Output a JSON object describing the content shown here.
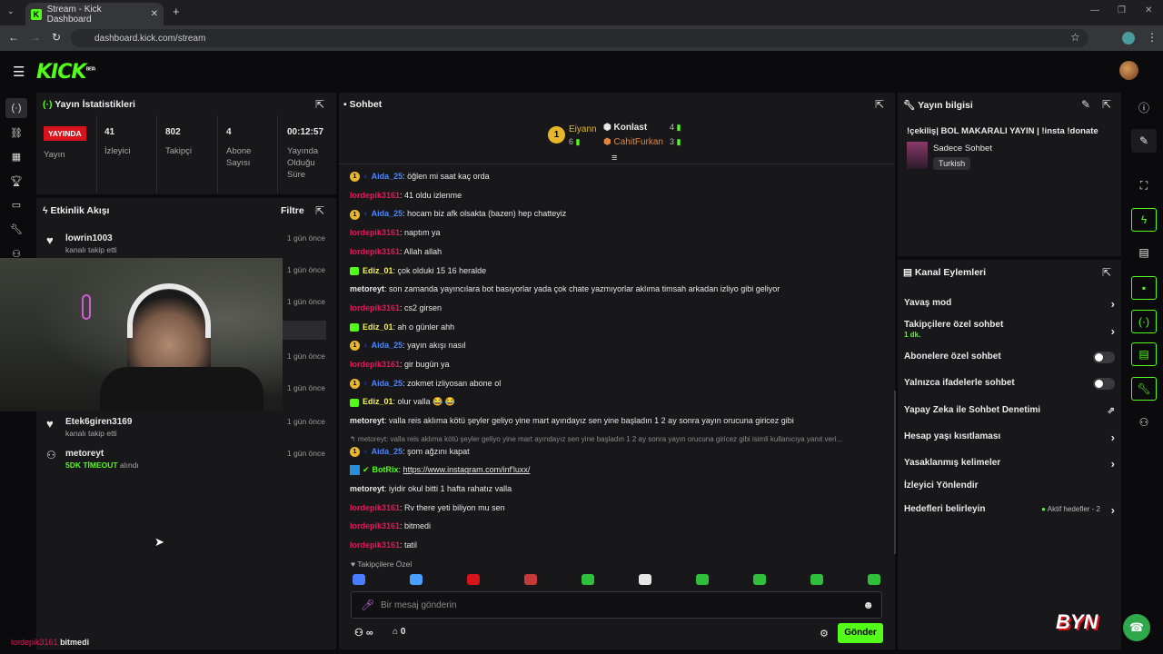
{
  "browser": {
    "tab_title": "Stream - Kick Dashboard",
    "url": "dashboard.kick.com/stream"
  },
  "brand": {
    "logo": "KICK",
    "beta": "BETA",
    "accent": "#53fc18",
    "live_red": "#d8131b"
  },
  "stats": {
    "title": "Yayın İstatistikleri",
    "live_badge": "YAYINDA",
    "live_label": "Yayın",
    "items": [
      {
        "value": "41",
        "label": "İzleyici"
      },
      {
        "value": "802",
        "label": "Takipçi"
      },
      {
        "value": "4",
        "label": "Abone Sayısı"
      },
      {
        "value": "00:12:57",
        "label": "Yayında Olduğu Süre"
      }
    ]
  },
  "activity": {
    "title": "Etkinlik Akışı",
    "filter": "Filtre",
    "items": [
      {
        "name": "lowrin1003",
        "sub": "kanalı takip etti",
        "time": "1 gün önce"
      },
      {
        "time": "1 gün önce"
      },
      {
        "time": "1 gün önce"
      },
      {
        "time": "1 gün önce"
      },
      {
        "time": "1 gün önce"
      },
      {
        "name": "Etek6giren3169",
        "sub": "kanalı takip etti",
        "time": "1 gün önce"
      },
      {
        "name": "metoreyt",
        "sub_highlight": "5DK TİMEOUT",
        "sub": "alındı",
        "time": "1 gün önce"
      }
    ]
  },
  "chat": {
    "title": "Sohbet",
    "leaders": [
      {
        "rank": "1",
        "name": "Eiyann",
        "count": "6"
      },
      {
        "name": "Konlast",
        "count": "4"
      },
      {
        "name": "CahitFurkan",
        "count": "3"
      }
    ],
    "messages": [
      {
        "user": "Aida_25",
        "cls": "u-aida",
        "badge": "1",
        "text": "öğlen mi saat kaç orda"
      },
      {
        "user": "lordepik3161",
        "cls": "u-lord",
        "text": "41 oldu izlenme"
      },
      {
        "user": "Aida_25",
        "cls": "u-aida",
        "badge": "1",
        "text": "hocam biz afk olsakta (bazen) hep chatteyiz"
      },
      {
        "user": "lordepik3161",
        "cls": "u-lord",
        "text": "naptım ya"
      },
      {
        "user": "lordepik3161",
        "cls": "u-lord",
        "text": "Allah allah"
      },
      {
        "user": "Ediz_01",
        "cls": "u-ediz",
        "badge": "sub",
        "text": "çok olduki 15 16 heralde"
      },
      {
        "user": "metoreyt",
        "cls": "u-meto",
        "text": "son zamanda yayıncılara bot basıyorlar yada çok chate yazmıyorlar aklıma timsah arkadan izliyo gibi geliyor"
      },
      {
        "user": "lordepik3161",
        "cls": "u-lord",
        "text": "cs2 girsen"
      },
      {
        "user": "Ediz_01",
        "cls": "u-ediz",
        "badge": "sub",
        "text": "ah o günler ahh"
      },
      {
        "user": "Aida_25",
        "cls": "u-aida",
        "badge": "1",
        "text": "yayın akışı nasıl"
      },
      {
        "user": "lordepik3161",
        "cls": "u-lord",
        "text": "gir bugün ya"
      },
      {
        "user": "Aida_25",
        "cls": "u-aida",
        "badge": "1",
        "text": "zokmet izliyosan abone ol"
      },
      {
        "user": "Ediz_01",
        "cls": "u-ediz",
        "badge": "sub",
        "text": "olur valla 😂 😂"
      },
      {
        "user": "metoreyt",
        "cls": "u-meto",
        "text": "valla reis aklıma kötü şeyler geliyo yine mart ayındayız sen yine başladın 1 2 ay sonra yayın orucuna giricez gibi"
      },
      {
        "reply": "↰ metoreyt: valla reis aklıma kötü şeyler geliyo yine mart ayındayız sen yine başladın 1 2 ay sonra yayın orucuna giricez gibi isimli kullanıcıya yanıt veri..."
      },
      {
        "user": "Aida_25",
        "cls": "u-aida",
        "badge": "1",
        "text": "şom ağzını kapat"
      },
      {
        "user": "BotRix",
        "cls": "u-bot",
        "badge": "bot",
        "text": "https://www.instagram.com/inf'luxx/"
      },
      {
        "user": "metoreyt",
        "cls": "u-meto",
        "text": "iyidir okul bitti 1 hafta rahatız valla"
      },
      {
        "user": "lordepik3161",
        "cls": "u-lord",
        "text": "Rv there yeti biliyon mu sen"
      },
      {
        "user": "lordepik3161",
        "cls": "u-lord",
        "text": "bitmedi"
      },
      {
        "user": "lordepik3161",
        "cls": "u-lord",
        "text": "tatil"
      }
    ],
    "emote_label": "Takipçilere Özel",
    "placeholder": "Bir mesaj gönderin",
    "points": "∞",
    "gift_count": "0",
    "send": "Gönder"
  },
  "stream_info": {
    "title": "Yayın bilgisi",
    "stream_title": "!çekiliş| BOL MAKARALI YAYIN | !insta !donate",
    "category": "Sadece Sohbet",
    "language": "Turkish"
  },
  "channel_actions": {
    "title": "Kanal Eylemleri",
    "rows": [
      {
        "label": "Yavaş mod"
      },
      {
        "label": "Takipçilere özel sohbet",
        "sub": "1 dk."
      },
      {
        "label": "Abonelere özel sohbet"
      },
      {
        "label": "Yalnızca ifadelerle sohbet"
      },
      {
        "label": "Yapay Zeka ile Sohbet Denetimi"
      },
      {
        "label": "Hesap yaşı kısıtlaması"
      },
      {
        "label": "Yasaklanmış kelimeler"
      },
      {
        "label": "İzleyici Yönlendir"
      },
      {
        "label": "Hedefleri belirleyin",
        "sub": "Aktif hedefler - 2"
      }
    ]
  },
  "overlay": {
    "user": "lordepik3161",
    "text": "bitmedi",
    "logo": "BYN"
  }
}
